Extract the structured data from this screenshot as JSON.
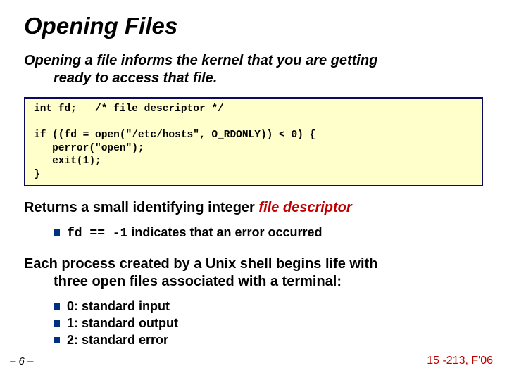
{
  "title": "Opening Files",
  "intro_line1": "Opening a file informs the kernel that you are getting",
  "intro_line2": "ready to access that file.",
  "code": "int fd;   /* file descriptor */\n\nif ((fd = open(\"/etc/hosts\", O_RDONLY)) < 0) {\n   perror(\"open\");\n   exit(1);\n}",
  "returns_plain": "Returns a small identifying integer ",
  "returns_em": "file descriptor",
  "fd_bullet_code": "fd == -1",
  "fd_bullet_rest": " indicates that an error occurred",
  "shell_line1": "Each process created by a Unix shell begins life with",
  "shell_line2": "three open files associated with a terminal:",
  "std": {
    "in": "0: standard input",
    "out": "1: standard output",
    "err": "2: standard error"
  },
  "footer_left": "– 6 –",
  "footer_right": "15 -213, F'06"
}
